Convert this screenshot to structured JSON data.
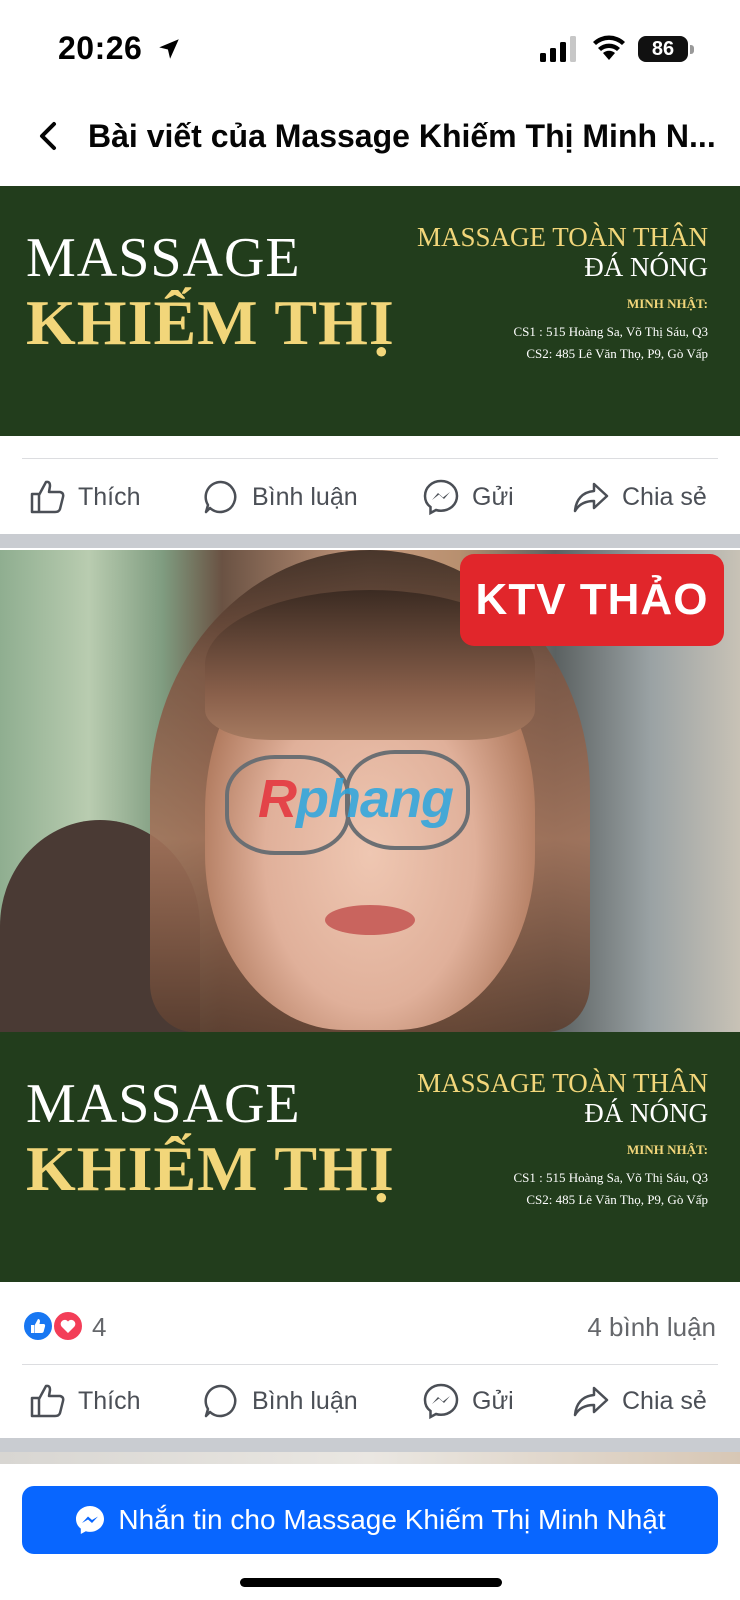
{
  "status_bar": {
    "time": "20:26",
    "battery": "86",
    "icons": [
      "location-arrow-icon",
      "signal-icon",
      "wifi-icon",
      "battery-icon"
    ]
  },
  "header": {
    "title": "Bài viết của Massage Khiếm Thị Minh N...",
    "back_icon": "chevron-left-icon"
  },
  "banner": {
    "massage": "MASSAGE",
    "khiem_thi": "KHIẾM THỊ",
    "line1": "MASSAGE TOÀN THÂN",
    "line2": "ĐÁ NÓNG",
    "line3": "MINH NHẬT:",
    "line4": "CS1 : 515 Hoàng Sa, Võ Thị Sáu, Q3",
    "line5": "CS2:  485 Lê Văn Thọ, P9, Gò Vấp",
    "colors": {
      "background": "#223d1c",
      "gold": "#f2d67a"
    }
  },
  "actions": {
    "like": "Thích",
    "comment": "Bình luận",
    "send": "Gửi",
    "share": "Chia sẻ"
  },
  "photo": {
    "badge": "KTV THẢO",
    "watermark_first": "R",
    "watermark_rest": "phang"
  },
  "reactions": {
    "count": "4",
    "comments": "4 bình luận",
    "icons": [
      "like-reaction-icon",
      "love-reaction-icon"
    ]
  },
  "message_button": {
    "label": "Nhắn tin cho Massage Khiếm Thị Minh Nhật",
    "color": "#0866ff",
    "icon": "messenger-icon"
  }
}
